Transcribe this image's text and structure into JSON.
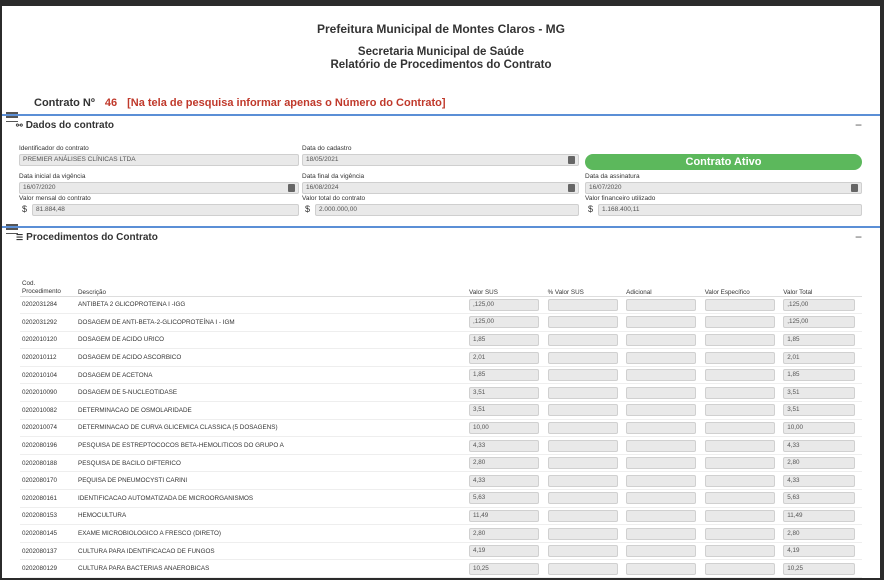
{
  "header": {
    "title": "Prefeitura Municipal de Montes Claros - MG",
    "subtitle1": "Secretaria Municipal de Saúde",
    "subtitle2": "Relatório de Procedimentos do Contrato"
  },
  "contrato": {
    "label": "Contrato Nº",
    "numero": "46",
    "hint": "[Na tela de pesquisa informar apenas o Número do Contrato]"
  },
  "dados": {
    "title": "Dados do contrato",
    "identificador_label": "Identificador do contrato",
    "identificador": "PREMIER ANÁLISES CLÍNICAS LTDA",
    "data_cadastro_label": "Data do cadastro",
    "data_cadastro": "18/05/2021",
    "status": "Contrato Ativo",
    "vig_ini_label": "Data inicial da vigência",
    "vig_ini": "16/07/2020",
    "vig_fim_label": "Data final da vigência",
    "vig_fim": "16/08/2024",
    "assinatura_label": "Data da assinatura",
    "assinatura": "16/07/2020",
    "valor_mensal_label": "Valor mensal do contrato",
    "valor_mensal": "81.884,48",
    "valor_total_label": "Valor total do contrato",
    "valor_total": "2.000.000,00",
    "valor_fin_label": "Valor financeiro utilizado",
    "valor_fin": "1.168.400,11",
    "currency": "$"
  },
  "procedimentos": {
    "title": "Procedimentos do Contrato",
    "columns": [
      "Cod. Procedimento",
      "Descrição",
      "Valor SUS",
      "% Valor SUS",
      "Adicional",
      "Valor Específico",
      "Valor Total"
    ],
    "rows": [
      {
        "cod": "0202031284",
        "desc": "ANTIBETA 2 GLICOPROTEINA I -IGG",
        "sus": ",125,00",
        "tot": ",125,00"
      },
      {
        "cod": "0202031292",
        "desc": "DOSAGEM DE ANTI-BETA-2-GLICOPROTEÍNA I - IGM",
        "sus": ",125,00",
        "tot": ",125,00"
      },
      {
        "cod": "0202010120",
        "desc": "DOSAGEM DE ACIDO URICO",
        "sus": "1,85",
        "tot": "1,85"
      },
      {
        "cod": "0202010112",
        "desc": "DOSAGEM DE ACIDO ASCORBICO",
        "sus": "2,01",
        "tot": "2,01"
      },
      {
        "cod": "0202010104",
        "desc": "DOSAGEM DE ACETONA",
        "sus": "1,85",
        "tot": "1,85"
      },
      {
        "cod": "0202010090",
        "desc": "DOSAGEM DE 5-NUCLEOTIDASE",
        "sus": "3,51",
        "tot": "3,51"
      },
      {
        "cod": "0202010082",
        "desc": "DETERMINACAO DE OSMOLARIDADE",
        "sus": "3,51",
        "tot": "3,51"
      },
      {
        "cod": "0202010074",
        "desc": "DETERMINACAO DE CURVA GLICEMICA CLASSICA (5 DOSAGENS)",
        "sus": "10,00",
        "tot": "10,00"
      },
      {
        "cod": "0202080196",
        "desc": "PESQUISA DE ESTREPTOCOCOS BETA-HEMOLITICOS DO GRUPO A",
        "sus": "4,33",
        "tot": "4,33"
      },
      {
        "cod": "0202080188",
        "desc": "PESQUISA DE BACILO DIFTERICO",
        "sus": "2,80",
        "tot": "2,80"
      },
      {
        "cod": "0202080170",
        "desc": "PEQUISA DE PNEUMOCYSTI CARINI",
        "sus": "4,33",
        "tot": "4,33"
      },
      {
        "cod": "0202080161",
        "desc": "IDENTIFICACAO AUTOMATIZADA DE MICROORGANISMOS",
        "sus": "5,63",
        "tot": "5,63"
      },
      {
        "cod": "0202080153",
        "desc": "HEMOCULTURA",
        "sus": "11,49",
        "tot": "11,49"
      },
      {
        "cod": "0202080145",
        "desc": "EXAME MICROBIOLOGICO A FRESCO (DIRETO)",
        "sus": "2,80",
        "tot": "2,80"
      },
      {
        "cod": "0202080137",
        "desc": "CULTURA PARA IDENTIFICACAO DE FUNGOS",
        "sus": "4,19",
        "tot": "4,19"
      },
      {
        "cod": "0202080129",
        "desc": "CULTURA PARA BACTERIAS ANAEROBICAS",
        "sus": "10,25",
        "tot": "10,25"
      }
    ]
  }
}
